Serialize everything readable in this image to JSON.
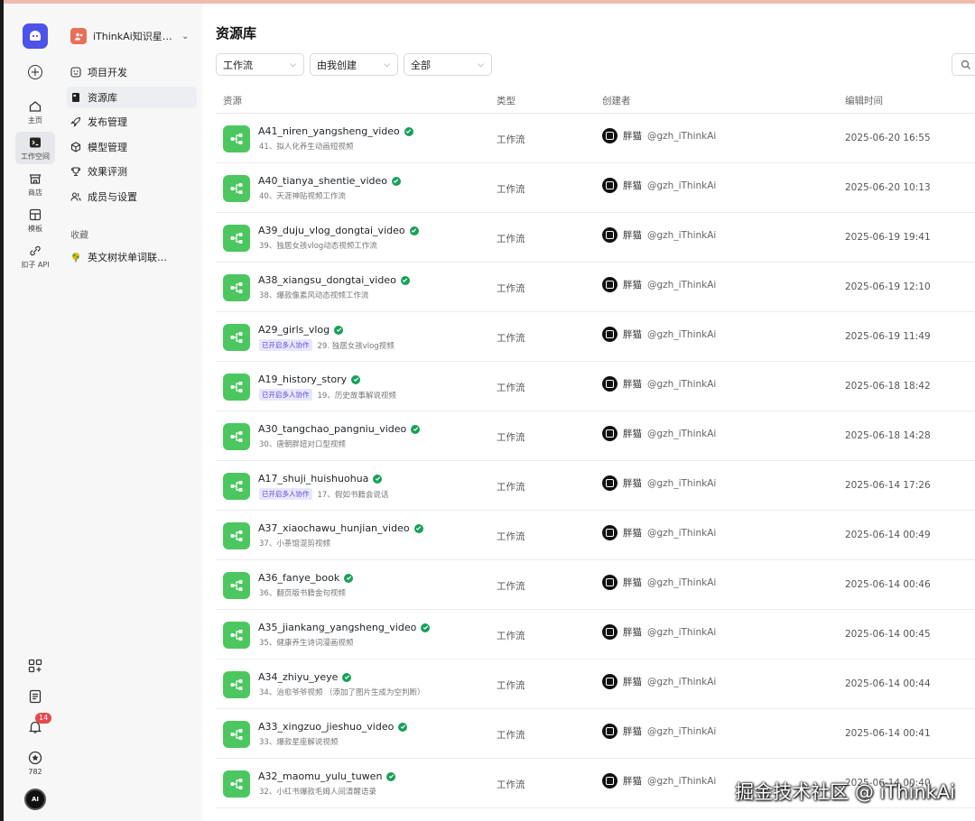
{
  "rail": {
    "items": [
      {
        "label": "主页",
        "icon": "home-icon"
      },
      {
        "label": "工作空间",
        "icon": "terminal-icon",
        "active": true
      },
      {
        "label": "商店",
        "icon": "store-icon"
      },
      {
        "label": "模板",
        "icon": "template-icon"
      },
      {
        "label": "扣子 API",
        "icon": "api-icon"
      }
    ],
    "notification_count": "14",
    "star_count": "782"
  },
  "sidebar": {
    "workspace_name": "iThinkAi知识星…",
    "nav": [
      {
        "label": "项目开发",
        "icon": "smile-icon"
      },
      {
        "label": "资源库",
        "icon": "library-icon",
        "active": true
      },
      {
        "label": "发布管理",
        "icon": "rocket-icon"
      },
      {
        "label": "模型管理",
        "icon": "model-icon"
      },
      {
        "label": "效果评测",
        "icon": "evaluate-icon"
      },
      {
        "label": "成员与设置",
        "icon": "members-icon"
      }
    ],
    "favorites_title": "收藏",
    "favorites": [
      {
        "label": "英文树状单词联…"
      }
    ]
  },
  "main": {
    "title": "资源库",
    "filters": [
      {
        "value": "工作流"
      },
      {
        "value": "由我创建"
      },
      {
        "value": "全部"
      }
    ],
    "columns": [
      "资源",
      "类型",
      "创建者",
      "编辑时间"
    ],
    "rows": [
      {
        "name": "A41_niren_yangsheng_video",
        "desc": "41、拟人化养生动画短视频",
        "tag": "",
        "type": "工作流",
        "creator": "胖猫",
        "handle": "@gzh_iThinkAi",
        "time": "2025-06-20 16:55"
      },
      {
        "name": "A40_tianya_shentie_video",
        "desc": "40、天涯神贴视频工作流",
        "tag": "",
        "type": "工作流",
        "creator": "胖猫",
        "handle": "@gzh_iThinkAi",
        "time": "2025-06-20 10:13"
      },
      {
        "name": "A39_duju_vlog_dongtai_video",
        "desc": "39、独居女孩vlog动态视频工作流",
        "tag": "",
        "type": "工作流",
        "creator": "胖猫",
        "handle": "@gzh_iThinkAi",
        "time": "2025-06-19 19:41"
      },
      {
        "name": "A38_xiangsu_dongtai_video",
        "desc": "38、爆款像素风动态视频工作流",
        "tag": "",
        "type": "工作流",
        "creator": "胖猫",
        "handle": "@gzh_iThinkAi",
        "time": "2025-06-19 12:10"
      },
      {
        "name": "A29_girls_vlog",
        "desc": "29. 独居女孩vlog视频",
        "tag": "已开启多人协作",
        "type": "工作流",
        "creator": "胖猫",
        "handle": "@gzh_iThinkAi",
        "time": "2025-06-19 11:49"
      },
      {
        "name": "A19_history_story",
        "desc": "19、历史故事解说视频",
        "tag": "已开启多人协作",
        "type": "工作流",
        "creator": "胖猫",
        "handle": "@gzh_iThinkAi",
        "time": "2025-06-18 18:42"
      },
      {
        "name": "A30_tangchao_pangniu_video",
        "desc": "30、唐朝胖妞对口型视频",
        "tag": "",
        "type": "工作流",
        "creator": "胖猫",
        "handle": "@gzh_iThinkAi",
        "time": "2025-06-18 14:28"
      },
      {
        "name": "A17_shuji_huishuohua",
        "desc": "17、假如书籍会说话",
        "tag": "已开启多人协作",
        "type": "工作流",
        "creator": "胖猫",
        "handle": "@gzh_iThinkAi",
        "time": "2025-06-14 17:26"
      },
      {
        "name": "A37_xiaochawu_hunjian_video",
        "desc": "37、小茶馆混剪视频",
        "tag": "",
        "type": "工作流",
        "creator": "胖猫",
        "handle": "@gzh_iThinkAi",
        "time": "2025-06-14 00:49"
      },
      {
        "name": "A36_fanye_book",
        "desc": "36、翻页版书籍金句视频",
        "tag": "",
        "type": "工作流",
        "creator": "胖猫",
        "handle": "@gzh_iThinkAi",
        "time": "2025-06-14 00:46"
      },
      {
        "name": "A35_jiankang_yangsheng_video",
        "desc": "35、健康养生诗词漫画视频",
        "tag": "",
        "type": "工作流",
        "creator": "胖猫",
        "handle": "@gzh_iThinkAi",
        "time": "2025-06-14 00:45"
      },
      {
        "name": "A34_zhiyu_yeye",
        "desc": "34、治愈爷爷视频 （添加了图片生成为空判断）",
        "tag": "",
        "type": "工作流",
        "creator": "胖猫",
        "handle": "@gzh_iThinkAi",
        "time": "2025-06-14 00:44"
      },
      {
        "name": "A33_xingzuo_jieshuo_video",
        "desc": "33、爆款星座解说视频",
        "tag": "",
        "type": "工作流",
        "creator": "胖猫",
        "handle": "@gzh_iThinkAi",
        "time": "2025-06-14 00:41"
      },
      {
        "name": "A32_maomu_yulu_tuwen",
        "desc": "32、小红书爆款毛姆人间清醒语录",
        "tag": "",
        "type": "工作流",
        "creator": "胖猫",
        "handle": "@gzh_iThinkAi",
        "time": "2025-06-14 00:40"
      }
    ]
  },
  "watermark": "掘金技术社区 @ iThinkAi",
  "colors": {
    "accent": "#4d53e8",
    "workflow_green": "#4cc760",
    "check_green": "#18a058",
    "badge_red": "#e5484d"
  }
}
